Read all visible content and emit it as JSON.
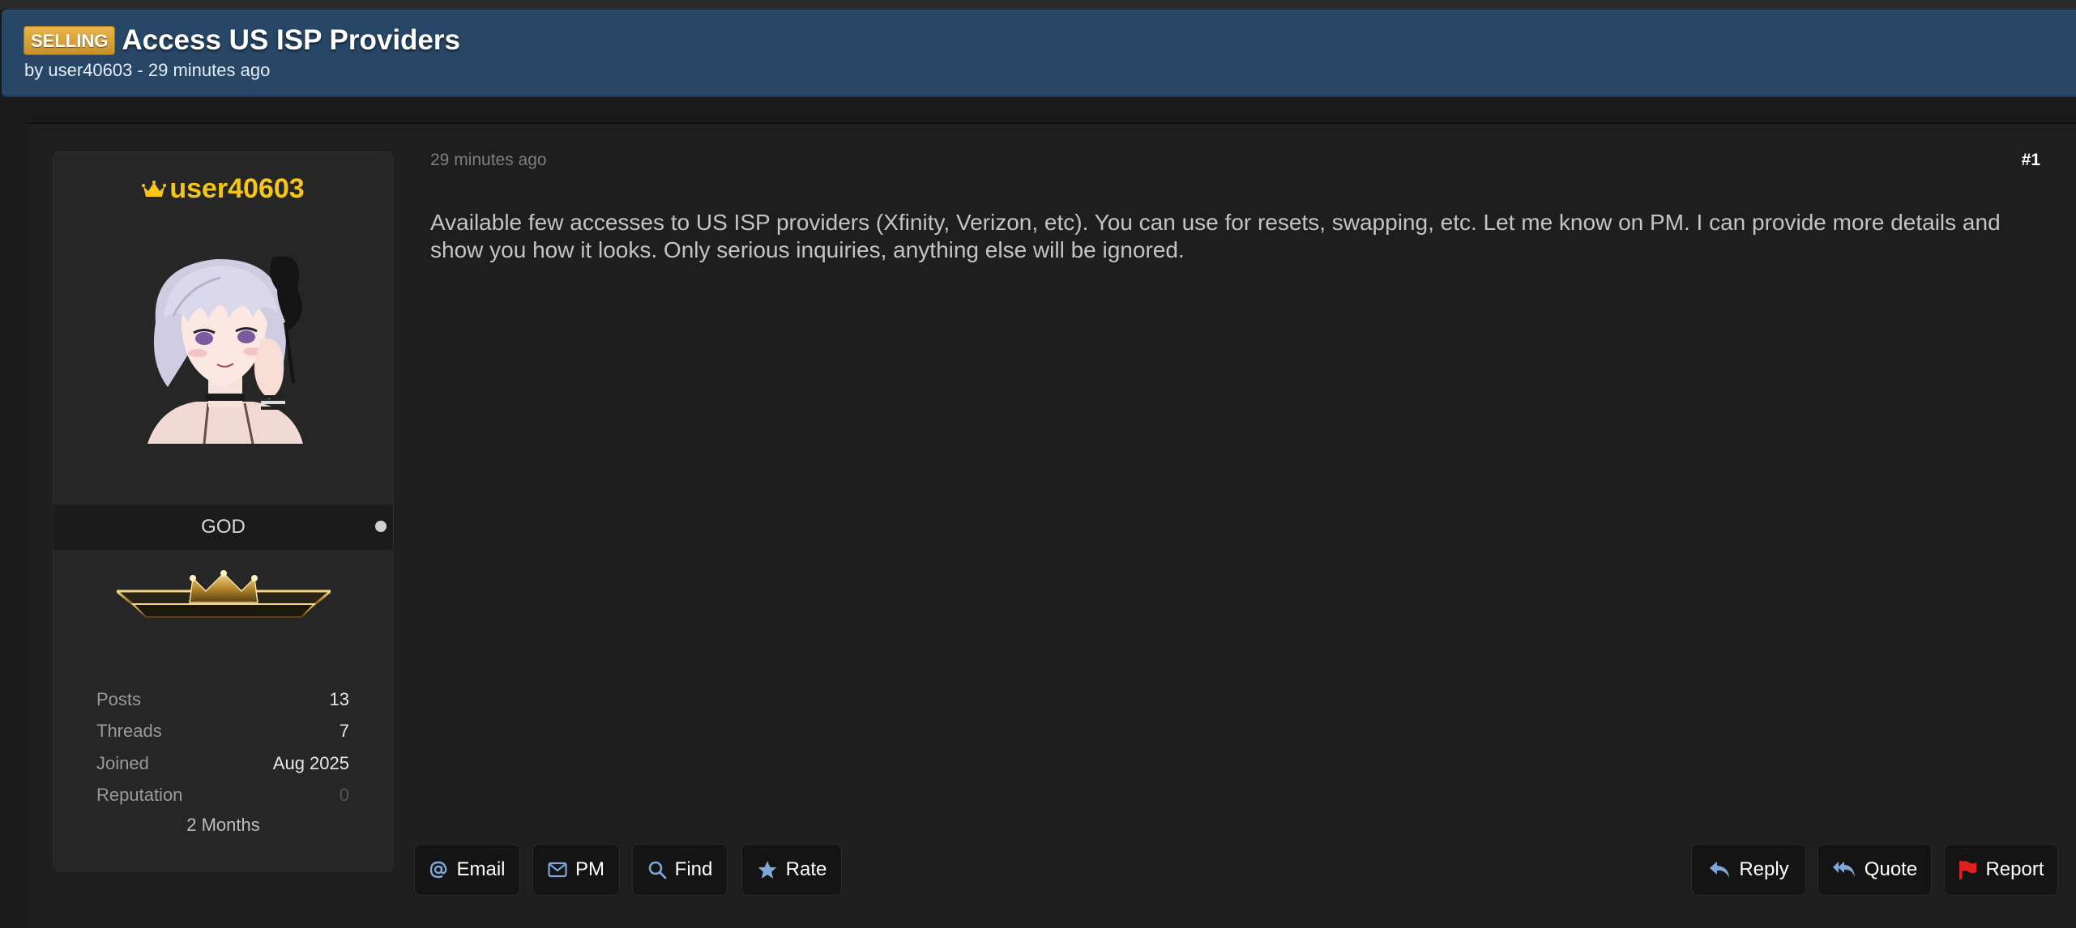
{
  "thread": {
    "prefix": "SELLING",
    "title": "Access US ISP Providers",
    "byline": "by user40603 - 29 minutes ago"
  },
  "user": {
    "username": "user40603",
    "rank": "GOD",
    "stats": [
      {
        "label": "Posts",
        "value": "13"
      },
      {
        "label": "Threads",
        "value": "7"
      },
      {
        "label": "Joined",
        "value": "Aug 2025"
      },
      {
        "label": "Reputation",
        "value": "0"
      }
    ],
    "membership": "2 Months"
  },
  "post": {
    "time": "29 minutes ago",
    "number": "#1",
    "content": "Available few accesses to US ISP providers (Xfinity, Verizon, etc). You can use for resets, swapping, etc. Let me know on PM. I can provide more details and show you how it looks. Only serious inquiries, anything else will be ignored."
  },
  "actions_left": [
    {
      "label": "Email",
      "icon": "at-icon"
    },
    {
      "label": "PM",
      "icon": "envelope-icon"
    },
    {
      "label": "Find",
      "icon": "search-icon"
    },
    {
      "label": "Rate",
      "icon": "star-icon"
    }
  ],
  "actions_right": [
    {
      "label": "Reply",
      "icon": "reply-icon"
    },
    {
      "label": "Quote",
      "icon": "reply-all-icon"
    },
    {
      "label": "Report",
      "icon": "flag-icon"
    }
  ],
  "colors": {
    "header_bg": "#284766",
    "username": "#f5c518",
    "prefix_badge": "#d9a23c",
    "report_flag": "#e02020",
    "icon_blue": "#7fa6d6"
  }
}
